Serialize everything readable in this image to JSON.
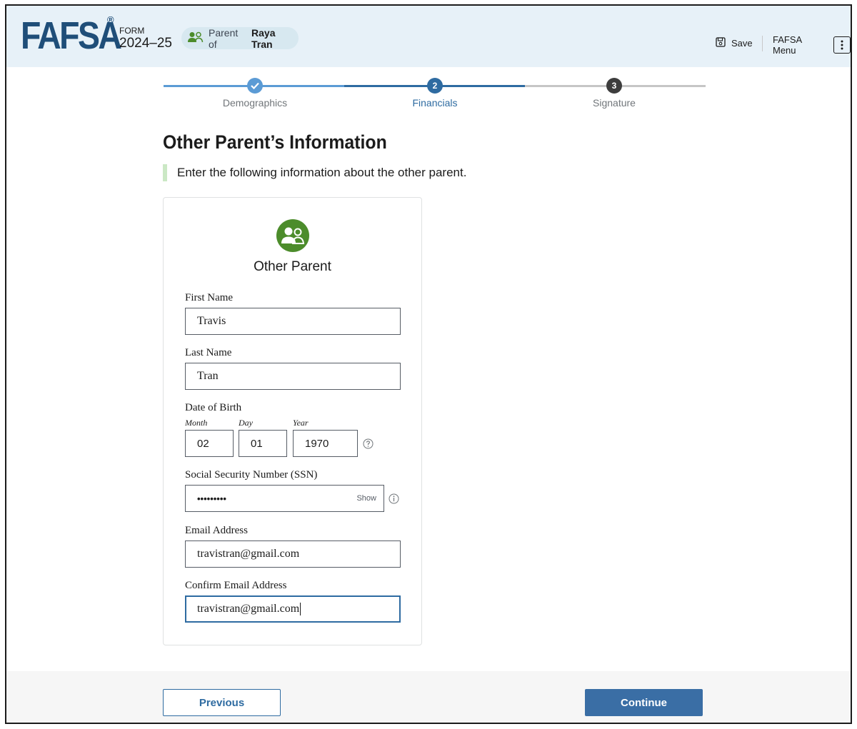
{
  "header": {
    "logo": "FAFSA",
    "logo_mark": "®",
    "form_label": "FORM",
    "form_year": "2024–25",
    "role_prefix": "Parent of",
    "role_name": "Raya Tran",
    "save_label": "Save",
    "menu_label": "FAFSA Menu"
  },
  "stepper": {
    "steps": [
      {
        "label": "Demographics",
        "number": "1",
        "state": "complete"
      },
      {
        "label": "Financials",
        "number": "2",
        "state": "current"
      },
      {
        "label": "Signature",
        "number": "3",
        "state": "upcoming"
      }
    ]
  },
  "main": {
    "title": "Other Parent’s Information",
    "intro": "Enter the following information about the other parent."
  },
  "card": {
    "title": "Other Parent",
    "fields": {
      "first_name": {
        "label": "First Name",
        "value": "Travis"
      },
      "last_name": {
        "label": "Last Name",
        "value": "Tran"
      },
      "dob": {
        "label": "Date of Birth",
        "month_label": "Month",
        "month": "02",
        "day_label": "Day",
        "day": "01",
        "year_label": "Year",
        "year": "1970"
      },
      "ssn": {
        "label": "Social Security Number (SSN)",
        "value": "•••••••••",
        "toggle": "Show"
      },
      "email": {
        "label": "Email Address",
        "value": "travistran@gmail.com"
      },
      "confirm_email": {
        "label": "Confirm Email Address",
        "value": "travistran@gmail.com"
      }
    }
  },
  "footer": {
    "previous_label": "Previous",
    "continue_label": "Continue"
  },
  "colors": {
    "brand_navy": "#1f4e79",
    "primary_blue": "#2e6ba1",
    "header_bg": "#e7f1f8",
    "icon_green": "#4c8c2b"
  }
}
